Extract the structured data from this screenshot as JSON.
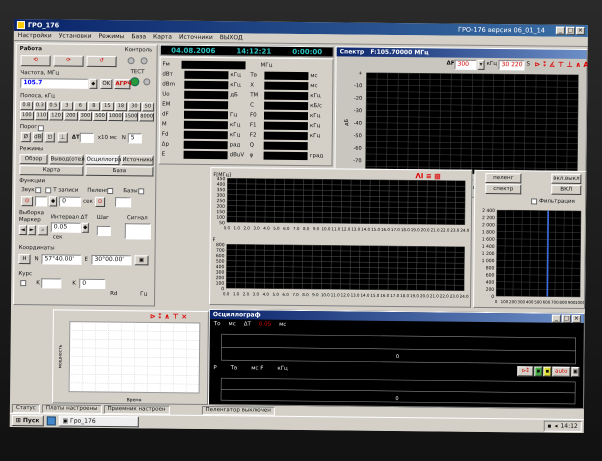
{
  "window": {
    "title": "ГРО_176",
    "version": "ГРО-176 версия 06_01_14"
  },
  "menu": [
    "Настройки",
    "Установки",
    "Режимы",
    "База",
    "Карта",
    "Источники",
    "ВЫХОД"
  ],
  "clock": {
    "date": "04.08.2006",
    "time": "14:12:21",
    "counter": "0:00:00"
  },
  "left": {
    "rabota_title": "Работа",
    "kontrol": "Контроль",
    "test": "ТЕСТ",
    "freq_label": "Частота, МГц",
    "freq_value": "105.7",
    "ok": "OK",
    "agc": "АГРЧ",
    "band_label": "Полоса, кГц",
    "bands_row1": [
      "0.8",
      "0.3",
      "0.5",
      "3",
      "6",
      "8",
      "15",
      "18",
      "30",
      "50"
    ],
    "bands_row2": [
      "100",
      "110",
      "120",
      "200",
      "300",
      "500",
      "1000",
      "1500",
      "8000"
    ],
    "porog": "Порог",
    "porog_dt": "ΔT",
    "porog_ms": "x10 мс",
    "porog_n": "N",
    "porog_n_val": "5",
    "modes_title": "Режимы",
    "modes": [
      "Обзор",
      "Вывод(отел)",
      "Осциллограф",
      "Источники"
    ],
    "modes2": [
      "Карта",
      "База"
    ],
    "func_title": "Функции",
    "zvuk": "Звук",
    "t_zapisi": "Т записи",
    "peleng": "Пеленг",
    "baza": "Базы",
    "vyborka": "Выборка",
    "marker": "Маркер",
    "interval": "Интервал ΔT",
    "interval_val": "0.05",
    "sek": "сек",
    "shag": "Шаг",
    "signal": "Сигнал",
    "coord_title": "Координаты",
    "coord_n": "N",
    "coord_n_val": "57°40.00'",
    "coord_e": "Е",
    "coord_e_val": "30°00.00'",
    "kurs": "Курс",
    "kurs_k": "K",
    "kurs_r": "Rd",
    "gc": "Гц"
  },
  "params": {
    "unit": "МГц",
    "rows": [
      [
        "Fм",
        "",
        "",
        ""
      ],
      [
        "dВт",
        "кГц",
        "Тв",
        "мс"
      ],
      [
        "dBm",
        "кГц",
        "X",
        "мс"
      ],
      [
        "Uo",
        "дБ",
        "TM",
        "кГц"
      ],
      [
        "ЕМ",
        "",
        "C",
        "кБ/с"
      ],
      [
        "dF",
        "Гц",
        "F0",
        "кГц"
      ],
      [
        "M",
        "кГц",
        "F1",
        "кГц"
      ],
      [
        "Fd",
        "кГц",
        "F2",
        "кГц"
      ],
      [
        "Δр",
        "рад",
        "Q",
        ""
      ],
      [
        "Е",
        "dBuV",
        "φ",
        "град"
      ]
    ]
  },
  "spectrum": {
    "title": "Спектр",
    "center": "F:105.70000 МГц",
    "df_label": "ΔF",
    "df_value": "300",
    "khz": "кГц",
    "span_value": "30 220",
    "s_label": "S",
    "xticks": [
      "-150",
      "-120",
      "-90",
      "-60",
      "-30",
      "0",
      "30",
      "60",
      "90",
      "120",
      "150"
    ],
    "yticks": [
      "+",
      "-10",
      "-20",
      "-30",
      "-40",
      "-50",
      "-60",
      "-70",
      "-80"
    ],
    "ylabel": "дБ",
    "xunit": "кГц"
  },
  "waterfall": {
    "ylabel": "F[МГц]",
    "yticks_top": [
      "450",
      "400",
      "350",
      "300",
      "250",
      "200",
      "150",
      "100",
      "50"
    ],
    "yticks_bottom": [
      "800",
      "700",
      "600",
      "500",
      "400",
      "300",
      "200",
      "100",
      "0"
    ],
    "xticks": [
      "0.0",
      "1.0",
      "2.0",
      "3.0",
      "4.0",
      "5.0",
      "6.0",
      "7.0",
      "8.0",
      "9.0",
      "10.0",
      "11.0",
      "12.0",
      "13.0",
      "14.0",
      "15.0",
      "16.0",
      "17.0",
      "18.0",
      "19.0",
      "20.0",
      "21.0",
      "22.0",
      "23.0",
      "24.0"
    ]
  },
  "right": {
    "peleng": "пеленг",
    "spektr": "спектр",
    "vkl": "ВКЛ",
    "ischis": "вкл.выкл",
    "filtration": "Фильтрация",
    "yticks": [
      "2 400",
      "2 200",
      "2 000",
      "1 800",
      "1 600",
      "1 400",
      "1 200",
      "1 000",
      "800",
      "600",
      "400",
      "200",
      "0"
    ],
    "xticks": [
      "0",
      "100",
      "200",
      "300",
      "400",
      "500",
      "600",
      "700",
      "800",
      "900",
      "1000"
    ]
  },
  "oscillograph": {
    "title": "Осциллограф",
    "row1": [
      "То",
      "мс",
      "ΔT",
      "0.05",
      "мс"
    ],
    "row2": [
      "Р",
      "Тв",
      "мс F",
      "кГц"
    ],
    "zero": "0",
    "mode": "auto"
  },
  "polar": {
    "ylabel": "мощность",
    "xlabel": "Время"
  },
  "status": [
    "Статус",
    "Платы настроены",
    "Приемник настроен",
    "Пеленгатор выключен"
  ],
  "taskbar": {
    "start": "Пуск",
    "app": "Гро_176",
    "clock": "14:12"
  }
}
